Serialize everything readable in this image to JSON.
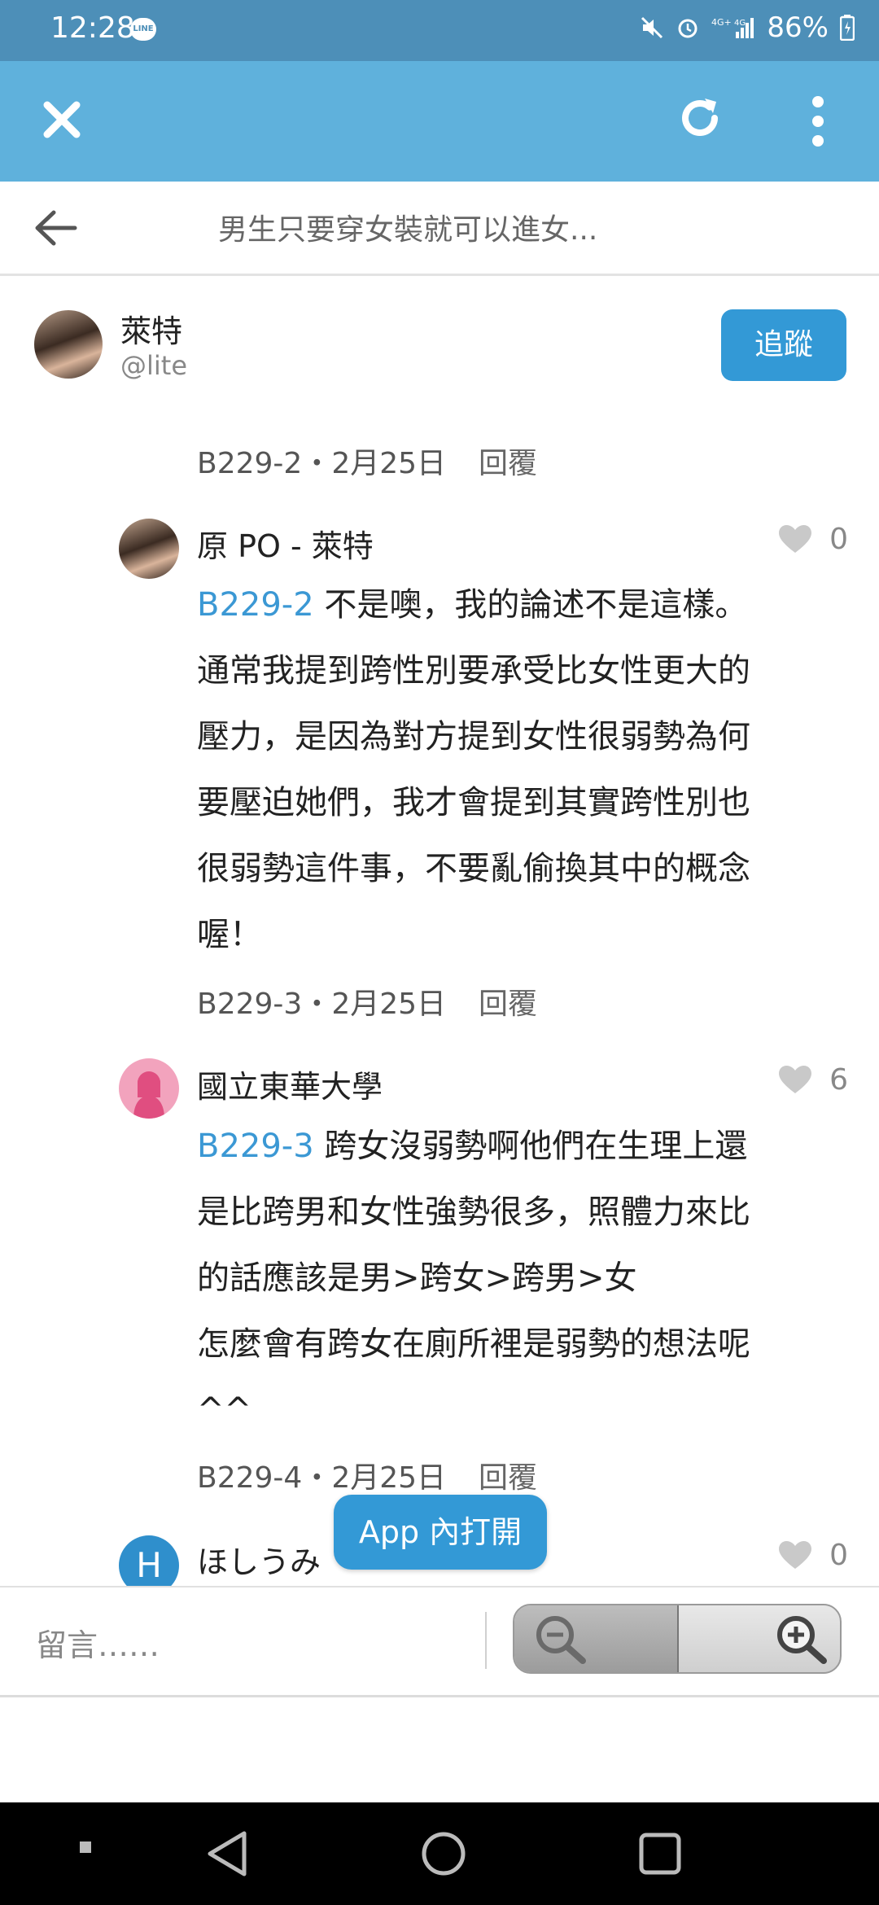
{
  "status_bar": {
    "time": "12:28",
    "battery": "86%",
    "line_badge": "LINE"
  },
  "header": {
    "title": "男生只要穿女裝就可以進女..."
  },
  "author": {
    "name": "萊特",
    "handle": "@lite",
    "follow_label": "追蹤"
  },
  "comments": [
    {
      "floor": "B229-2",
      "date": "2月25日",
      "reply_label": "回覆"
    },
    {
      "author": "原 PO - 萊特",
      "likes": "0",
      "reply_to": "B229-2",
      "lines": [
        "不是噢，我的論述不是這樣。",
        "通常我提到跨性別要承受比女性更大的",
        "壓力，是因為對方提到女性很弱勢為何",
        "要壓迫她們，我才會提到其實跨性別也",
        "很弱勢這件事，不要亂偷換其中的概念",
        "喔！"
      ],
      "floor": "B229-3",
      "date": "2月25日",
      "reply_label": "回覆"
    },
    {
      "author": "國立東華大學",
      "likes": "6",
      "reply_to": "B229-3",
      "lines": [
        "跨女沒弱勢啊他們在生理上還",
        "是比跨男和女性強勢很多，照體力來比",
        "的話應該是男>跨女>跨男>女",
        "怎麼會有跨女在廁所裡是弱勢的想法呢",
        "^^"
      ],
      "floor": "B229-4",
      "date": "2月25日",
      "reply_label": "回覆"
    },
    {
      "author": "ほしうみ",
      "likes": "0",
      "avatar_letter": "H"
    }
  ],
  "open_in_app": "App 內打開",
  "comment_input": {
    "placeholder": "留言……"
  },
  "colors": {
    "accent": "#3399d6",
    "app_bar": "#5fb1dc",
    "status_bar": "#4d8fb8",
    "link": "#3b98d4"
  }
}
